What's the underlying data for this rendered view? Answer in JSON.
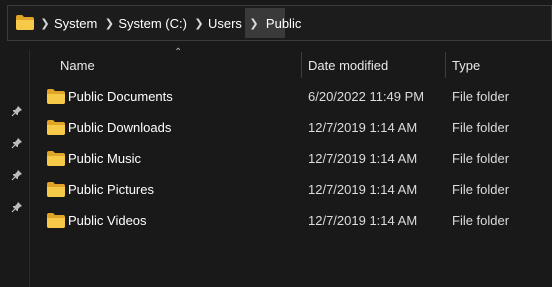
{
  "breadcrumb": {
    "root_icon": "folder-icon",
    "items": [
      {
        "label": "System"
      },
      {
        "label": "System (C:)"
      },
      {
        "label": "Users"
      },
      {
        "label": "Public"
      }
    ]
  },
  "nav": {
    "pins": [
      "pin-icon",
      "pin-icon",
      "pin-icon",
      "pin-icon"
    ]
  },
  "columns": {
    "name": "Name",
    "date_modified": "Date modified",
    "type": "Type",
    "sorted_by": "name"
  },
  "files": [
    {
      "name": "Public Documents",
      "date": "6/20/2022 11:49 PM",
      "type": "File folder",
      "icon": "folder-icon"
    },
    {
      "name": "Public Downloads",
      "date": "12/7/2019 1:14 AM",
      "type": "File folder",
      "icon": "folder-icon"
    },
    {
      "name": "Public Music",
      "date": "12/7/2019 1:14 AM",
      "type": "File folder",
      "icon": "folder-icon"
    },
    {
      "name": "Public Pictures",
      "date": "12/7/2019 1:14 AM",
      "type": "File folder",
      "icon": "folder-icon"
    },
    {
      "name": "Public Videos",
      "date": "12/7/2019 1:14 AM",
      "type": "File folder",
      "icon": "folder-icon"
    }
  ],
  "colors": {
    "background": "#191919",
    "folder_yellow": "#f7c948",
    "folder_dark": "#e0a526",
    "active_crumb": "#3a3a3a"
  }
}
